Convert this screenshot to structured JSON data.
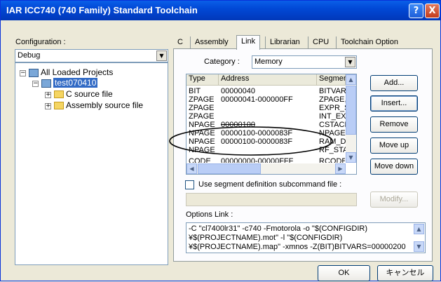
{
  "window": {
    "title": "IAR ICC740 (740 Family) Standard Toolchain",
    "help_label": "?",
    "close_label": "X"
  },
  "config": {
    "label": "Configuration :",
    "value": "Debug"
  },
  "tree": {
    "root": "All Loaded Projects",
    "project": "test070410",
    "children": [
      "C source file",
      "Assembly source file"
    ],
    "expander_collapsed": "+",
    "expander_expanded": "−"
  },
  "tabs": [
    "C",
    "Assembly",
    "Link",
    "Librarian",
    "CPU",
    "Toolchain Option"
  ],
  "active_tab": "Link",
  "category": {
    "label": "Category :",
    "value": "Memory"
  },
  "table": {
    "headers": [
      "Type",
      "Address",
      "Segment"
    ],
    "rows": [
      [
        "BIT",
        "00000040",
        "BITVARS"
      ],
      [
        "ZPAGE",
        "00000041-000000FF",
        "ZPAGE,C"
      ],
      [
        "ZPAGE",
        "",
        "EXPR_STA"
      ],
      [
        "ZPAGE",
        "",
        "INT_EXPR"
      ],
      [
        "NPAGE",
        "00000100",
        "CSTACK+"
      ],
      [
        "NPAGE",
        "00000100-0000083F",
        "NPAGE,C"
      ],
      [
        "NPAGE",
        "00000100-0000083F",
        "RAM_DAT"
      ],
      [
        "NPAGE",
        "",
        "RF_STACI"
      ],
      [
        "CODE",
        "00000000-00000FFF",
        "RCODE,Z"
      ]
    ]
  },
  "buttons": {
    "add": "Add...",
    "insert": "Insert...",
    "remove": "Remove",
    "move_up": "Move up",
    "move_down": "Move down",
    "modify": "Modify...",
    "ok": "OK",
    "cancel": "キャンセル"
  },
  "segment_check_label": "Use segment definition subcommand file :",
  "options": {
    "label": "Options Link :",
    "lines": [
      "-C \"cl7400lr31\" -c740 -Fmotorola -o \"$(CONFIGDIR)",
      "¥$(PROJECTNAME).mot\" -l \"$(CONFIGDIR)",
      "¥$(PROJECTNAME).map\" -xmnos -Z(BIT)BITVARS=00000200"
    ]
  },
  "colors": {
    "title_bar": "#0148d6",
    "selection": "#316ac5",
    "dialog_bg": "#ece9d8"
  }
}
